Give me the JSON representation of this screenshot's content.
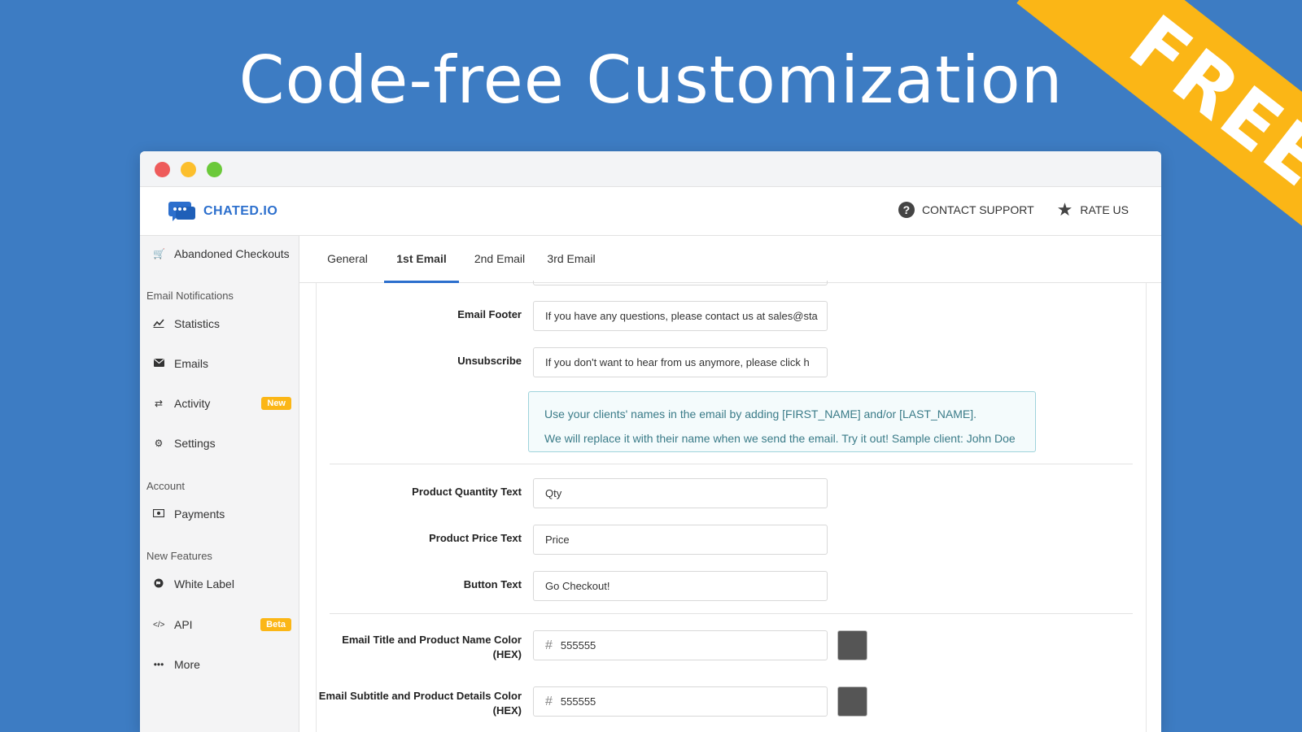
{
  "banner": {
    "headline": "Code-free Customization",
    "ribbon": "FREE"
  },
  "header": {
    "logo_text": "CHATED.IO",
    "contact_support": "CONTACT SUPPORT",
    "rate_us": "RATE US"
  },
  "sidebar": {
    "top_item": "Abandoned Checkouts",
    "section_email": "Email Notifications",
    "statistics": "Statistics",
    "emails": "Emails",
    "activity": "Activity",
    "activity_badge": "New",
    "settings": "Settings",
    "section_account": "Account",
    "payments": "Payments",
    "section_features": "New Features",
    "white_label": "White Label",
    "api": "API",
    "api_badge": "Beta",
    "more": "More"
  },
  "tabs": [
    "General",
    "1st Email",
    "2nd Email",
    "3rd Email"
  ],
  "active_tab": "1st Email",
  "form": {
    "email_footer_label": "Email Footer",
    "email_footer_value": "If you have any questions, please contact us at sales@sta",
    "unsubscribe_label": "Unsubscribe",
    "unsubscribe_value": "If you don't want to hear from us anymore, please click h",
    "info_line1": "Use your clients' names in the email by adding [FIRST_NAME] and/or [LAST_NAME].",
    "info_line2": "We will replace it with their name when we send the email. Try it out! Sample client: John Doe",
    "qty_label": "Product Quantity Text",
    "qty_value": "Qty",
    "price_label": "Product Price Text",
    "price_value": "Price",
    "button_label": "Button Text",
    "button_value": "Go Checkout!",
    "title_color_label": "Email Title and Product Name Color (HEX)",
    "title_color_value": "555555",
    "subtitle_color_label": "Email Subtitle and Product Details Color (HEX)",
    "subtitle_color_value": "555555",
    "hash": "#"
  },
  "colors": {
    "background": "#3d7cc3",
    "ribbon": "#fbb616",
    "accent": "#2c6fcd",
    "swatch": "#555555"
  }
}
